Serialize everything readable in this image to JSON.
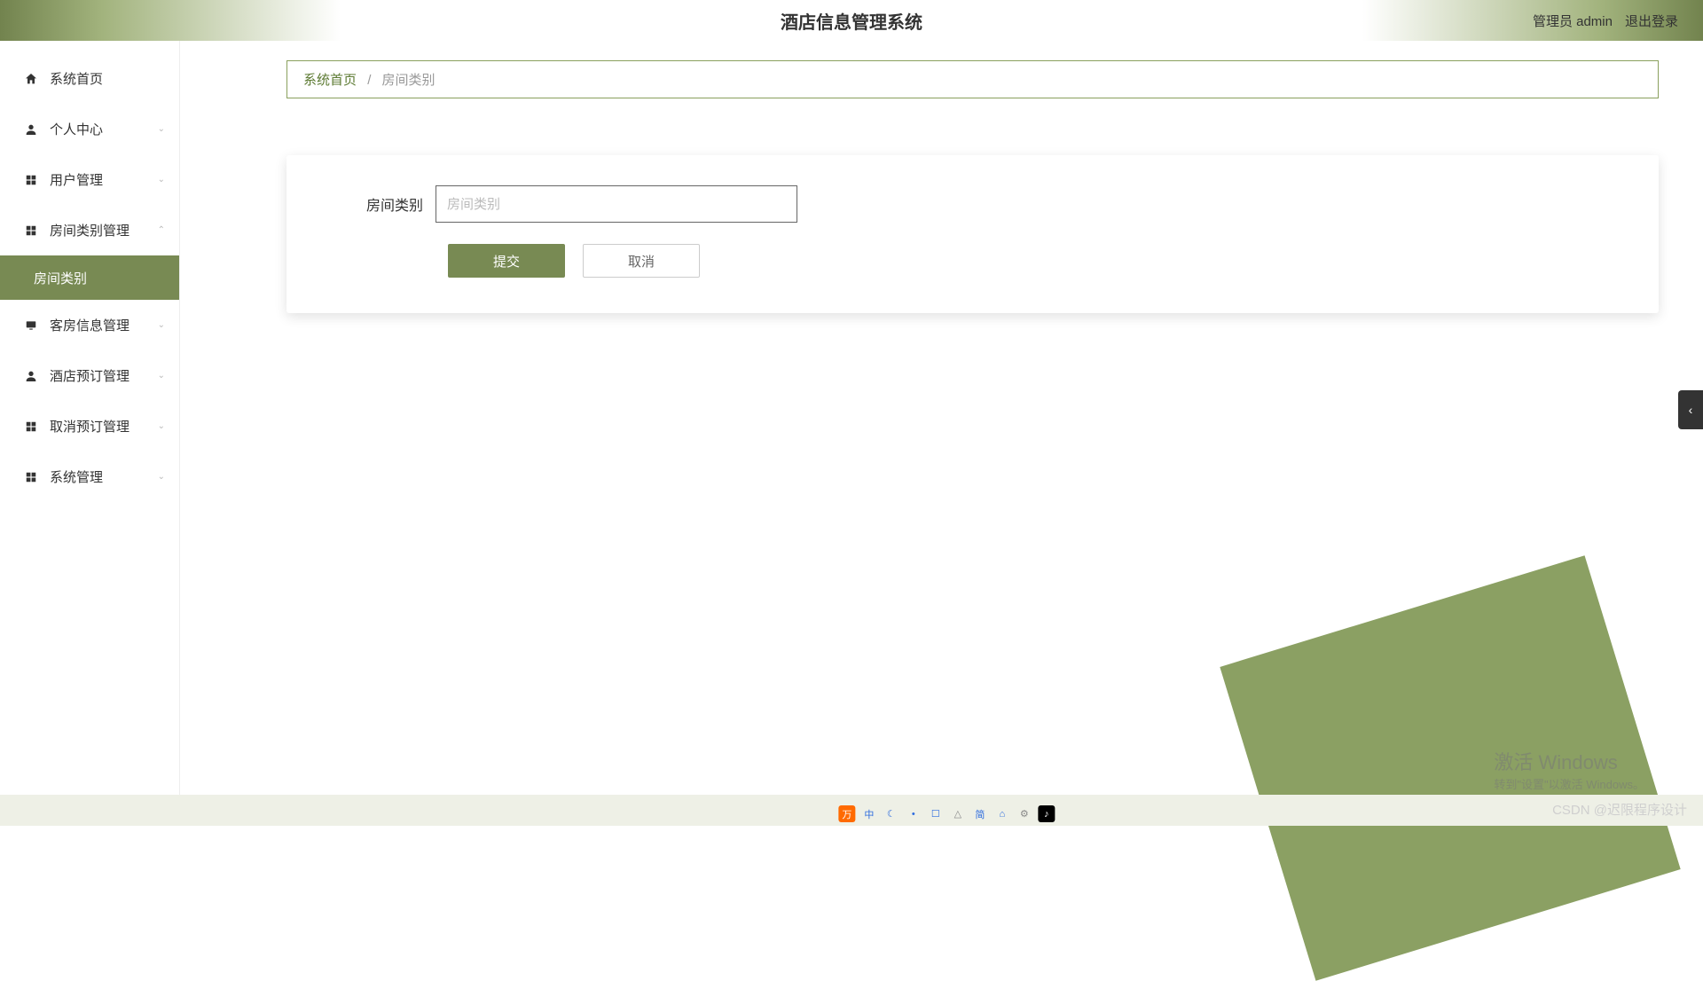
{
  "header": {
    "title": "酒店信息管理系统",
    "role": "管理员 admin",
    "logout": "退出登录"
  },
  "sidebar": {
    "items": [
      {
        "icon": "home",
        "label": "系统首页",
        "arrow": ""
      },
      {
        "icon": "person",
        "label": "个人中心",
        "arrow": "⌄"
      },
      {
        "icon": "grid",
        "label": "用户管理",
        "arrow": "⌄"
      },
      {
        "icon": "grid",
        "label": "房间类别管理",
        "arrow": "⌃"
      },
      {
        "icon": "monitor",
        "label": "客房信息管理",
        "arrow": "⌄"
      },
      {
        "icon": "person",
        "label": "酒店预订管理",
        "arrow": "⌄"
      },
      {
        "icon": "grid",
        "label": "取消预订管理",
        "arrow": "⌄"
      },
      {
        "icon": "grid",
        "label": "系统管理",
        "arrow": "⌄"
      }
    ],
    "subActive": "房间类别"
  },
  "breadcrumb": {
    "home": "系统首页",
    "sep": "/",
    "current": "房间类别"
  },
  "form": {
    "label": "房间类别",
    "placeholder": "房间类别",
    "value": "",
    "submit": "提交",
    "cancel": "取消"
  },
  "activate": {
    "title": "激活 Windows",
    "sub": "转到\"设置\"以激活 Windows。"
  },
  "watermark": "CSDN @迟限程序设计",
  "tray": [
    "万",
    "中",
    "☾",
    "•",
    "☐",
    "△",
    "简",
    "⌂",
    "⚙",
    "♪"
  ]
}
